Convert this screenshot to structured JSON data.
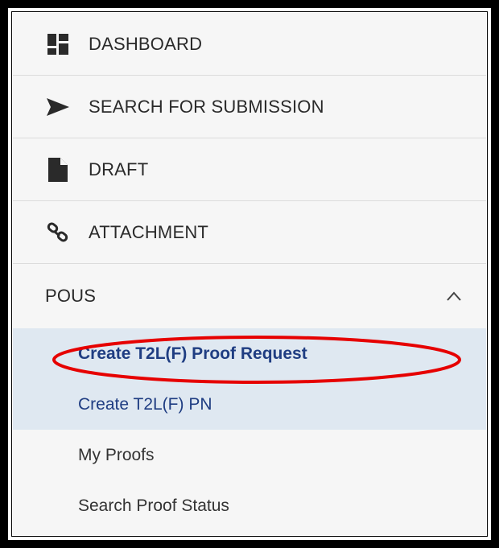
{
  "menu": {
    "items": [
      {
        "label": "DASHBOARD",
        "icon": "dashboard-icon"
      },
      {
        "label": "SEARCH FOR SUBMISSION",
        "icon": "send-icon"
      },
      {
        "label": "DRAFT",
        "icon": "document-icon"
      },
      {
        "label": "ATTACHMENT",
        "icon": "link-icon"
      }
    ],
    "section": {
      "label": "POUS",
      "expanded": true,
      "chevron_icon": "chevron-up-icon",
      "sub_items": [
        {
          "label": "Create T2L(F) Proof Request",
          "active": true
        },
        {
          "label": "Create T2L(F) PN",
          "active": true
        },
        {
          "label": "My Proofs",
          "active": false
        },
        {
          "label": "Search Proof Status",
          "active": false
        }
      ]
    }
  },
  "colors": {
    "active_bg": "#dfe8f1",
    "active_text": "#1f3d82",
    "annotation_ellipse": "#e60000"
  }
}
